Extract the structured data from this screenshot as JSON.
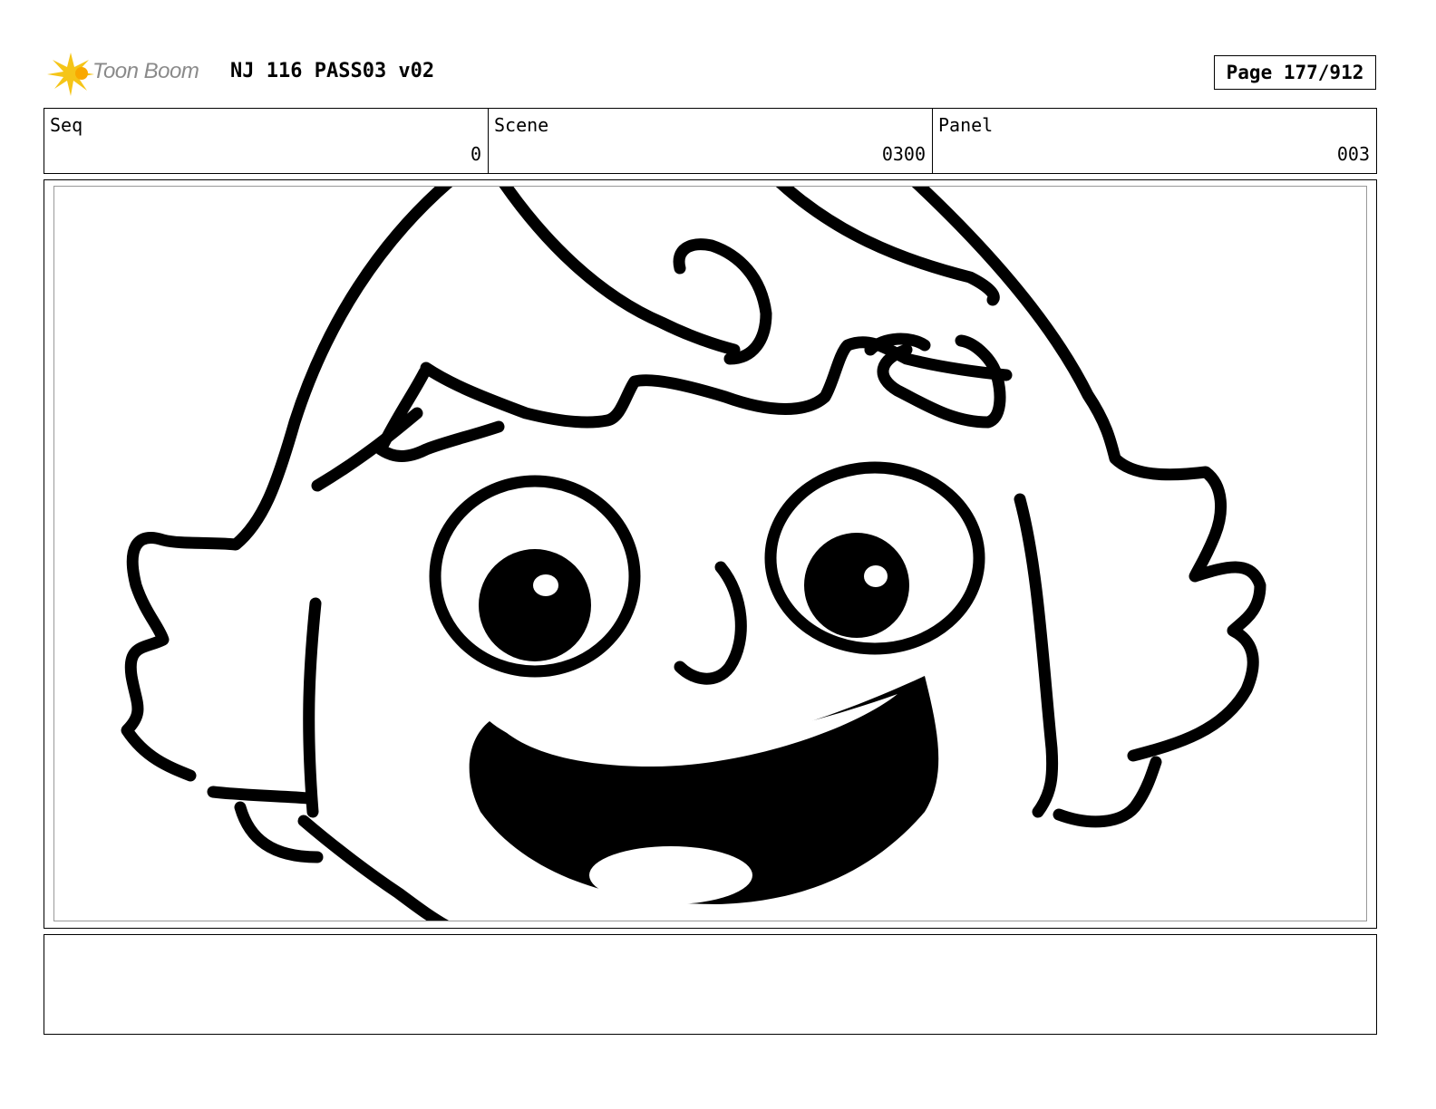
{
  "header": {
    "logo_text": "Toon Boom",
    "title": "NJ 116 PASS03 v02",
    "page_label": "Page 177/912"
  },
  "info": {
    "seq": {
      "label": "Seq",
      "value": "0"
    },
    "scene": {
      "label": "Scene",
      "value": "0300"
    },
    "panel": {
      "label": "Panel",
      "value": "003"
    }
  },
  "notes": {
    "text": ""
  },
  "colors": {
    "logo_accent": "#f5c518",
    "logo_text": "#8a8a8a",
    "inner_frame": "#999999"
  },
  "icons": {
    "logo": "toon-boom-star-icon"
  }
}
